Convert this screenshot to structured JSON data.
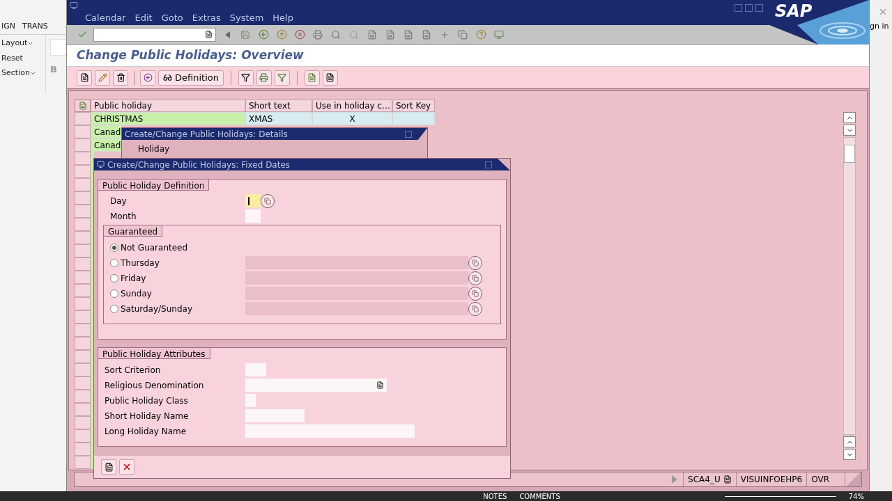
{
  "background_app": {
    "ribbon_tabs": [
      "IGN",
      "TRANS"
    ],
    "menu_items": [
      "Layout",
      "Reset",
      "Section"
    ],
    "dropdowns": [
      true,
      false,
      true
    ],
    "format_letter": "B",
    "sign_in": "gn in",
    "status": {
      "notes": "NOTES",
      "comments": "COMMENTS",
      "zoom": "74%"
    }
  },
  "window": {
    "menu": [
      "Calendar",
      "Edit",
      "Goto",
      "Extras",
      "System",
      "Help"
    ],
    "logo": "SAP",
    "title": "Change Public Holidays: Overview"
  },
  "toolbar": {
    "definition_button": "Definition"
  },
  "table": {
    "columns": [
      "Public holiday",
      "Short text",
      "Use in holiday c…",
      "Sort Key"
    ],
    "rows": [
      {
        "holiday": "CHRISTMAS",
        "short_text": "XMAS",
        "use_in_calendar": "X"
      },
      {
        "holiday": "Canad"
      },
      {
        "holiday": "Canad"
      }
    ]
  },
  "details_dialog": {
    "title": "Create/Change Public Holidays: Details",
    "label": "Holiday"
  },
  "fixed_dates_dialog": {
    "title": "Create/Change Public Holidays: Fixed Dates",
    "definition": {
      "title": "Public Holiday Definition",
      "fields": [
        {
          "label": "Day",
          "focused": true,
          "kind": "help"
        },
        {
          "label": "Month",
          "focused": false,
          "kind": "plain"
        }
      ]
    },
    "guaranteed": {
      "title": "Guaranteed",
      "options": [
        {
          "label": "Not Guaranteed",
          "selected": true,
          "kind": "plain"
        },
        {
          "label": "Thursday",
          "selected": false,
          "kind": "field"
        },
        {
          "label": "Friday",
          "selected": false,
          "kind": "field"
        },
        {
          "label": "Sunday",
          "selected": false,
          "kind": "field"
        },
        {
          "label": "Saturday/Sunday",
          "selected": false,
          "kind": "field"
        }
      ]
    },
    "attributes": {
      "title": "Public Holiday Attributes",
      "fields": [
        {
          "label": "Sort Criterion",
          "kind": "text"
        },
        {
          "label": "Religious Denomination",
          "kind": "dropdown"
        },
        {
          "label": "Public Holiday Class",
          "kind": "text"
        },
        {
          "label": "Short Holiday Name",
          "kind": "text"
        },
        {
          "label": "Long Holiday Name",
          "kind": "text"
        }
      ]
    }
  },
  "status_bar": {
    "items": [
      "SCA4_U",
      "VISUINFOEHP6",
      "OVR"
    ]
  }
}
